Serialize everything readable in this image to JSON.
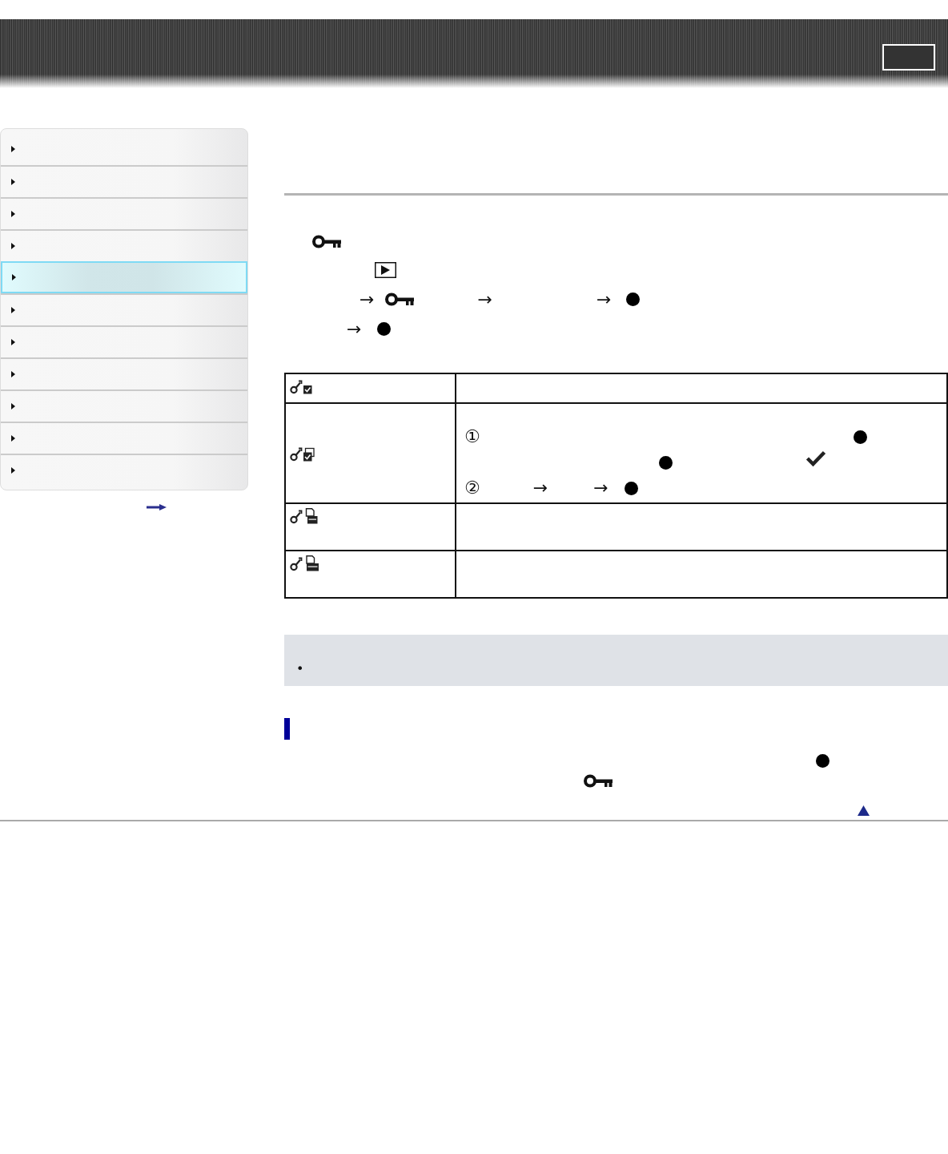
{
  "sidebar": {
    "items": [
      {
        "selected": false
      },
      {
        "selected": false
      },
      {
        "selected": false
      },
      {
        "selected": false
      },
      {
        "selected": true
      },
      {
        "selected": false
      },
      {
        "selected": false
      },
      {
        "selected": false
      },
      {
        "selected": false
      },
      {
        "selected": false
      },
      {
        "selected": false
      }
    ]
  },
  "steps": [
    {
      "tokens": [
        {
          "kind": "key"
        }
      ]
    },
    {
      "tokens": [
        {
          "kind": "play"
        }
      ]
    },
    {
      "tokens": [
        {
          "kind": "arrow",
          "text": "→"
        },
        {
          "kind": "key"
        },
        {
          "kind": "arrow",
          "text": "→"
        },
        {
          "kind": "arrow",
          "text": "→"
        },
        {
          "kind": "dot"
        }
      ]
    },
    {
      "tokens": [
        {
          "kind": "arrow",
          "text": "→"
        },
        {
          "kind": "dot"
        }
      ]
    }
  ],
  "table": {
    "rows": [
      {
        "kind": "checkbox"
      },
      {
        "kind": "double-checkbox",
        "lines": [
          {
            "tokens": [
              {
                "kind": "number",
                "text": "①"
              },
              {
                "kind": "dot"
              }
            ]
          },
          {
            "tokens": [
              {
                "kind": "dot"
              },
              {
                "kind": "check"
              }
            ]
          },
          {
            "tokens": [
              {
                "kind": "number",
                "text": "②"
              },
              {
                "kind": "arrow",
                "text": "→"
              },
              {
                "kind": "arrow",
                "text": "→"
              },
              {
                "kind": "dot"
              }
            ]
          }
        ]
      },
      {
        "kind": "card"
      },
      {
        "kind": "card-wide"
      }
    ]
  },
  "note": {
    "items": [
      {
        "bullet": "•"
      }
    ]
  },
  "hint": {
    "lines": [
      {
        "tokens": [
          {
            "kind": "dot"
          }
        ]
      },
      {
        "tokens": [
          {
            "kind": "key"
          }
        ]
      }
    ]
  }
}
